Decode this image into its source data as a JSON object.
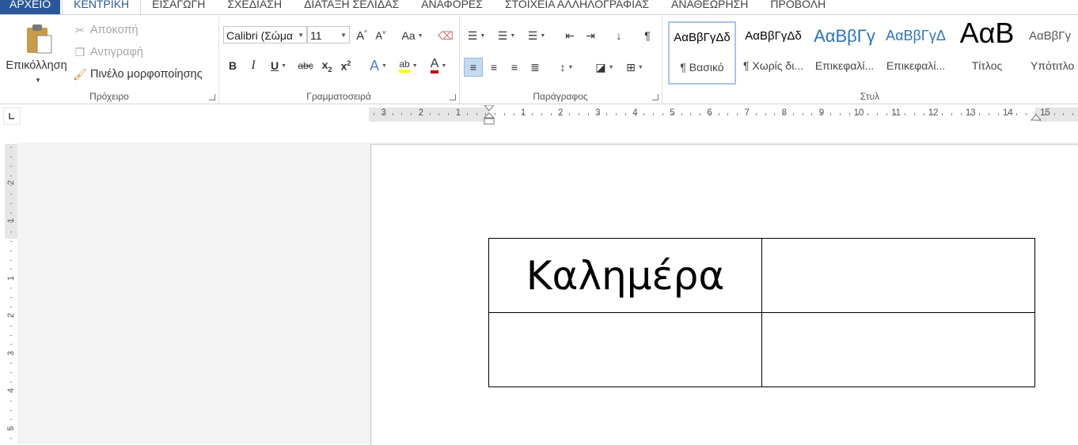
{
  "tabs": {
    "file": "ΑΡΧΕΙΟ",
    "home": "ΚΕΝΤΡΙΚΗ",
    "insert": "ΕΙΣΑΓΩΓΗ",
    "design": "ΣΧΕΔΙΑΣΗ",
    "layout": "ΔΙΑΤΑΞΗ ΣΕΛΙΔΑΣ",
    "references": "ΑΝΑΦΟΡΕΣ",
    "mailings": "ΣΤΟΙΧΕΙΑ ΑΛΛΗΛΟΓΡΑΦΙΑΣ",
    "review": "ΑΝΑΘΕΩΡΗΣΗ",
    "view": "ΠΡΟΒΟΛΗ"
  },
  "clipboard": {
    "paste": "Επικόλληση",
    "cut": "Αποκοπή",
    "copy": "Αντιγραφή",
    "format_painter": "Πινέλο μορφοποίησης",
    "label": "Πρόχειρο"
  },
  "font": {
    "name": "Calibri (Σώμα",
    "size": "11",
    "change_case": "Aa",
    "strikethrough": "abc",
    "label": "Γραμματοσειρά"
  },
  "paragraph": {
    "label": "Παράγραφος"
  },
  "styles": {
    "label": "Στυλ",
    "items": [
      {
        "preview": "ΑαΒβΓγΔδ",
        "name": "¶ Βασικό"
      },
      {
        "preview": "ΑαΒβΓγΔδ",
        "name": "¶ Χωρίς δι..."
      },
      {
        "preview": "ΑαΒβΓγ",
        "name": "Επικεφαλί..."
      },
      {
        "preview": "ΑαΒβΓγΔ",
        "name": "Επικεφαλί..."
      },
      {
        "preview": "ΑαΒ",
        "name": "Τίτλος"
      },
      {
        "preview": "ΑαΒβΓγ",
        "name": "Υπότιτλο"
      }
    ]
  },
  "ruler": {
    "h_left": [
      "3",
      "2",
      "1"
    ],
    "h_right": [
      "1",
      "2",
      "3",
      "4",
      "5",
      "6",
      "7",
      "8",
      "9",
      "10",
      "11",
      "12",
      "13",
      "14",
      "15"
    ],
    "v_top": [
      "2",
      "1"
    ],
    "v_body": [
      "1",
      "2",
      "3",
      "4",
      "5"
    ]
  },
  "document": {
    "table": [
      [
        "Καλημέρα",
        ""
      ],
      [
        "",
        ""
      ]
    ]
  }
}
